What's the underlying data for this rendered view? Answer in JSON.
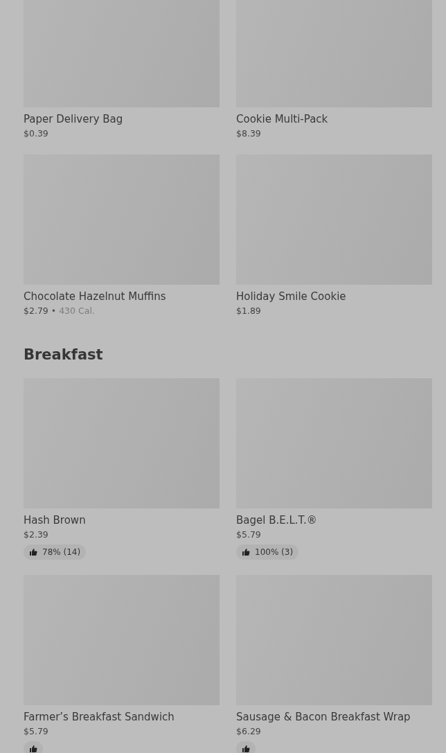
{
  "sections": [
    {
      "items": [
        {
          "name": "Paper Delivery Bag",
          "price": "$0.39"
        },
        {
          "name": "Cookie Multi-Pack",
          "price": "$8.39"
        },
        {
          "name": "Chocolate Hazelnut Muffins",
          "price": "$2.79",
          "separator": "•",
          "calories": "430 Cal."
        },
        {
          "name": "Holiday Smile Cookie",
          "price": "$1.89"
        }
      ]
    },
    {
      "heading": "Breakfast",
      "items": [
        {
          "name": "Hash Brown",
          "price": "$2.39",
          "rating": "78% (14)"
        },
        {
          "name": "Bagel B.E.L.T.®",
          "price": "$5.79",
          "rating": "100% (3)"
        },
        {
          "name": "Farmer’s Breakfast Sandwich",
          "price": "$5.79",
          "rating_cut": true
        },
        {
          "name": "Sausage & Bacon Breakfast Wrap",
          "price": "$6.29",
          "rating_cut": true
        }
      ]
    }
  ]
}
